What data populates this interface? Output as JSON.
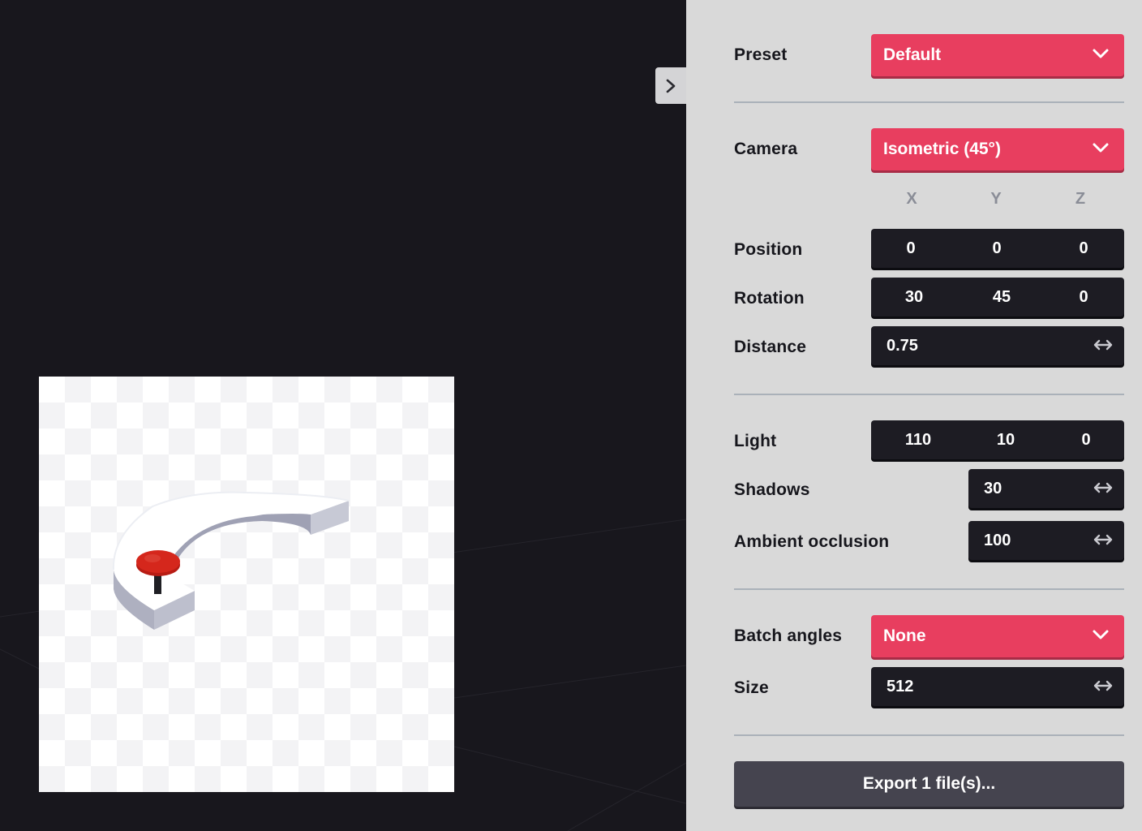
{
  "sidebar_toggle": {
    "icon": "chevron-right-icon"
  },
  "settings": {
    "preset": {
      "label": "Preset",
      "value": "Default"
    },
    "camera": {
      "label": "Camera",
      "value": "Isometric (45°)"
    },
    "axes": {
      "x": "X",
      "y": "Y",
      "z": "Z"
    },
    "position": {
      "label": "Position",
      "x": "0",
      "y": "0",
      "z": "0"
    },
    "rotation": {
      "label": "Rotation",
      "x": "30",
      "y": "45",
      "z": "0"
    },
    "distance": {
      "label": "Distance",
      "value": "0.75"
    },
    "light": {
      "label": "Light",
      "x": "110",
      "y": "10",
      "z": "0"
    },
    "shadows": {
      "label": "Shadows",
      "value": "30"
    },
    "ambient_occlusion": {
      "label": "Ambient occlusion",
      "value": "100"
    },
    "batch_angles": {
      "label": "Batch angles",
      "value": "None"
    },
    "size": {
      "label": "Size",
      "value": "512"
    }
  },
  "export_button": {
    "label": "Export 1 file(s)..."
  },
  "colors": {
    "accent": "#e83e5f",
    "panel_bg": "#d9d9d9",
    "field_bg": "#1d1c23",
    "viewport_bg": "#18171d",
    "export_bg": "#45444f"
  }
}
